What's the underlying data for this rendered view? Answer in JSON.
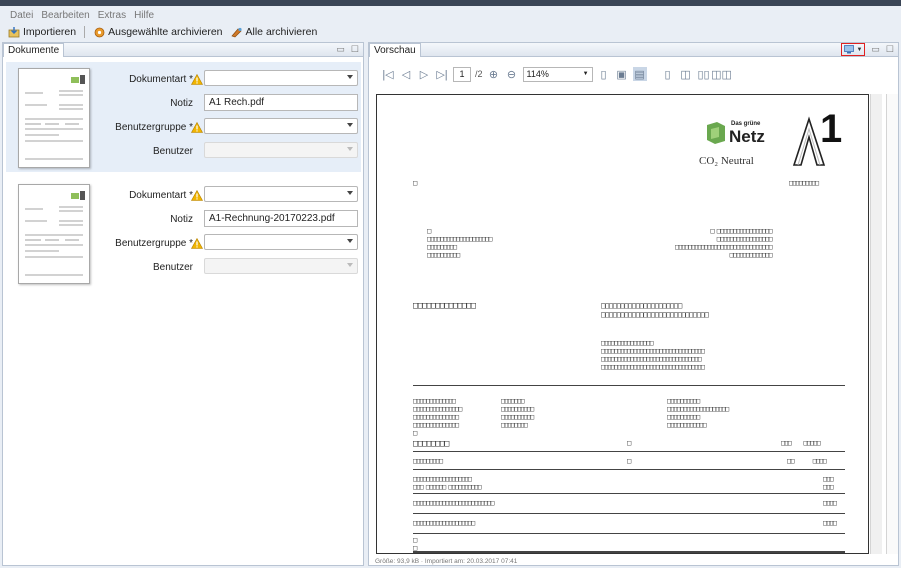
{
  "menu": {
    "items": [
      "Datei",
      "Bearbeiten",
      "Extras",
      "Hilfe"
    ]
  },
  "toolbar": {
    "import_label": "Importieren",
    "archive_selected_label": "Ausgewählte archivieren",
    "archive_all_label": "Alle archivieren"
  },
  "documents_panel": {
    "title": "Dokumente",
    "cards": [
      {
        "doc_type_label": "Dokumentart *",
        "note_label": "Notiz",
        "note_value": "A1 Rech.pdf",
        "user_group_label": "Benutzergruppe *",
        "user_label": "Benutzer"
      },
      {
        "doc_type_label": "Dokumentart *",
        "note_label": "Notiz",
        "note_value": "A1-Rechnung-20170223.pdf",
        "user_group_label": "Benutzergruppe *",
        "user_label": "Benutzer"
      }
    ]
  },
  "preview_panel": {
    "title": "Vorschau",
    "page_input": "1",
    "page_total": "/2",
    "zoom": "114%",
    "logo": {
      "small_text": "Das grüne",
      "big_text": "Netz",
      "co2_text": "CO₂ Neutral",
      "brand_number": "1"
    }
  },
  "status": {
    "text": "Größe: 93,9 kB · Importiert am: 20.03.2017 07:41"
  },
  "colors": {
    "accent": "#3a6fb5",
    "warning": "#f0b400",
    "green_logo": "#6aa84f",
    "highlight_box": "#e02020"
  }
}
